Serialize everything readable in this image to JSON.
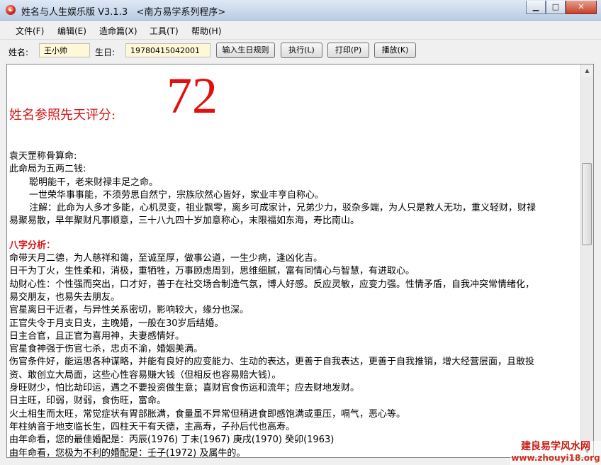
{
  "window": {
    "title": "姓名与人生娱乐版 V3.1.3   <南方易学系列程序>",
    "app_icon": "yin-yang-icon",
    "minimize": "▁",
    "maximize": "□",
    "close": "✕"
  },
  "menu": [
    "文件(F)",
    "编辑(E)",
    "造命篇(X)",
    "工具(T)",
    "帮助(H)"
  ],
  "toolbar": {
    "name_label": "姓名:",
    "name_value": "王小帅",
    "birthday_label": "生日:",
    "birthday_value": "19780415042001",
    "rules_button": "输入生日规则",
    "execute_button": "执行(L)",
    "print_button": "打印(P)",
    "play_button": "播放(K)"
  },
  "report": {
    "score_label": "姓名参照先天评分:",
    "score": "72",
    "lines": [
      "袁天罡称骨算命:",
      "此命局为五两二钱:",
      "聪明能干，老来财禄丰足之命。",
      "一世荣华事事能，不须劳思自然宁，宗族欣然心皆好，家业丰亨自称心。",
      "注解：此命为人多才多能，心机灵变，祖业飘零，离乡可成家计，兄弟少力，驳杂多端，为人只是救人无功，重义轻财，财禄",
      "易聚易散，早年聚财凡事顺意，三十八九四十岁加意称心，末限福如东海，寿比南山。",
      "八字分析：",
      "命带天月二德，为人慈祥和蔼，至诚至厚，做事公道，一生少病，逢凶化吉。",
      "日干为丁火，生性柔和，消极，重牺牲，万事顾虑周到，思维细腻，富有同情心与智慧，有进取心。",
      "劫财心性：个性强而突出，口才好，善于在社交场合制造气氛，博人好感。反应灵敏，应变力强。性情矛盾，自我冲突常情绪化，",
      "易交朋友，也易失去朋友。",
      "官星离日干近者，与异性关系密切，影响较大，缘分也深。",
      "正官失令于月支日支，主晚婚，一般在30岁后结婚。",
      "日主合官，且正官为喜用神，夫妻感情好。",
      "官星食神强于伤官七杀，忠贞不渝，婚姻美满。",
      "伤官条件好，能运思各种谋略，并能有良好的应变能力、生动的表达，更善于自我表达，更善于自我推销，增大经营层面，且敢投",
      "资、敢创立大局面，这些心性容易赚大钱（但相反也容易赔大钱）。",
      "身旺财少，怕比劫印运，遇之不要投资做生意；喜财官食伤运和流年；应去财地发财。",
      "日主旺，印弱，财弱，食伤旺，富命。",
      "火土相生而太旺，常觉症状有胃部胀满，食量虽不异常但稍进食即感饱满或重压，嗝气，恶心等。",
      "年柱纳音于地支临长生，四柱天干有天德，主高寿，子孙后代也高寿。",
      "由年命看，您的最佳婚配是：丙辰(1976)    丁未(1967)    庚戌(1970)    癸卯(1963)",
      "由年命看，您极为不利的婚配是：壬子(1972)   及属牛的。"
    ]
  },
  "watermark": {
    "line1": "建良易学风水网",
    "line2": "www.zhouyi18.org"
  }
}
